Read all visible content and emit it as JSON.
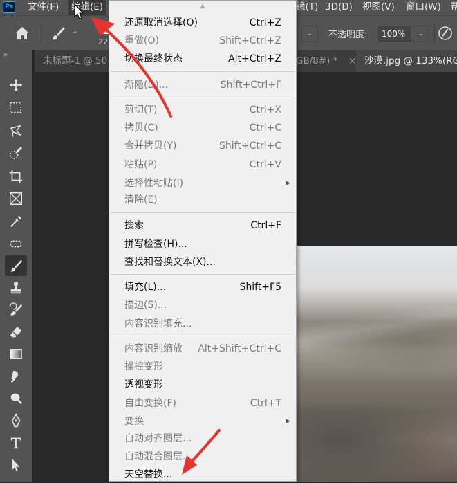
{
  "app": {
    "logo": "Ps"
  },
  "menubar": {
    "file": "文件(F)",
    "edit": "编辑(E)",
    "filter_partial": "镜(T)",
    "3d": "3D(D)",
    "view": "视图(V)",
    "window": "窗口(W)",
    "help_partial": "帮"
  },
  "options": {
    "brush_size_partial": "22",
    "opacity_label": "不透明度:",
    "opacity_value": "100%"
  },
  "tabs": [
    {
      "label": "未标题-1 @ 50"
    },
    {
      "label": "GB/8#) *"
    },
    {
      "label": "×"
    },
    {
      "label": "沙漠.jpg @ 133%(RG"
    }
  ],
  "edit_menu": [
    {
      "label": "还原取消选择(O)",
      "shortcut": "Ctrl+Z",
      "enabled": true
    },
    {
      "label": "重做(O)",
      "shortcut": "Shift+Ctrl+Z",
      "enabled": false
    },
    {
      "label": "切换最终状态",
      "shortcut": "Alt+Ctrl+Z",
      "enabled": true
    },
    {
      "label": "渐隐(D)...",
      "shortcut": "Shift+Ctrl+F",
      "enabled": false
    },
    {
      "label": "剪切(T)",
      "shortcut": "Ctrl+X",
      "enabled": false
    },
    {
      "label": "拷贝(C)",
      "shortcut": "Ctrl+C",
      "enabled": false
    },
    {
      "label": "合并拷贝(Y)",
      "shortcut": "Shift+Ctrl+C",
      "enabled": false
    },
    {
      "label": "粘贴(P)",
      "shortcut": "Ctrl+V",
      "enabled": false
    },
    {
      "label": "选择性粘贴(I)",
      "shortcut": "",
      "enabled": false,
      "submenu": true
    },
    {
      "label": "清除(E)",
      "shortcut": "",
      "enabled": false
    },
    {
      "label": "搜索",
      "shortcut": "Ctrl+F",
      "enabled": true
    },
    {
      "label": "拼写检查(H)...",
      "shortcut": "",
      "enabled": true
    },
    {
      "label": "查找和替换文本(X)...",
      "shortcut": "",
      "enabled": true
    },
    {
      "label": "填充(L)...",
      "shortcut": "Shift+F5",
      "enabled": true
    },
    {
      "label": "描边(S)...",
      "shortcut": "",
      "enabled": false
    },
    {
      "label": "内容识别填充...",
      "shortcut": "",
      "enabled": false
    },
    {
      "label": "内容识别缩放",
      "shortcut": "Alt+Shift+Ctrl+C",
      "enabled": false
    },
    {
      "label": "操控变形",
      "shortcut": "",
      "enabled": false
    },
    {
      "label": "透视变形",
      "shortcut": "",
      "enabled": true
    },
    {
      "label": "自由变换(F)",
      "shortcut": "Ctrl+T",
      "enabled": false
    },
    {
      "label": "变换",
      "shortcut": "",
      "enabled": false,
      "submenu": true
    },
    {
      "label": "自动对齐图层...",
      "shortcut": "",
      "enabled": false
    },
    {
      "label": "自动混合图层...",
      "shortcut": "",
      "enabled": false
    },
    {
      "label": "天空替换...",
      "shortcut": "",
      "enabled": true
    }
  ],
  "tools": [
    "move-icon",
    "marquee-icon",
    "lasso-icon",
    "quick-select-icon",
    "crop-icon",
    "frame-icon",
    "eyedropper-icon",
    "spot-heal-icon",
    "brush-icon",
    "stamp-icon",
    "history-brush-icon",
    "eraser-icon",
    "gradient-icon",
    "smudge-icon",
    "dodge-icon",
    "pen-icon",
    "type-icon",
    "path-select-icon"
  ],
  "colors": {
    "annotation_arrow": "#e8322c",
    "menu_bg": "#f0f0f0",
    "ui_panel": "#535353"
  }
}
